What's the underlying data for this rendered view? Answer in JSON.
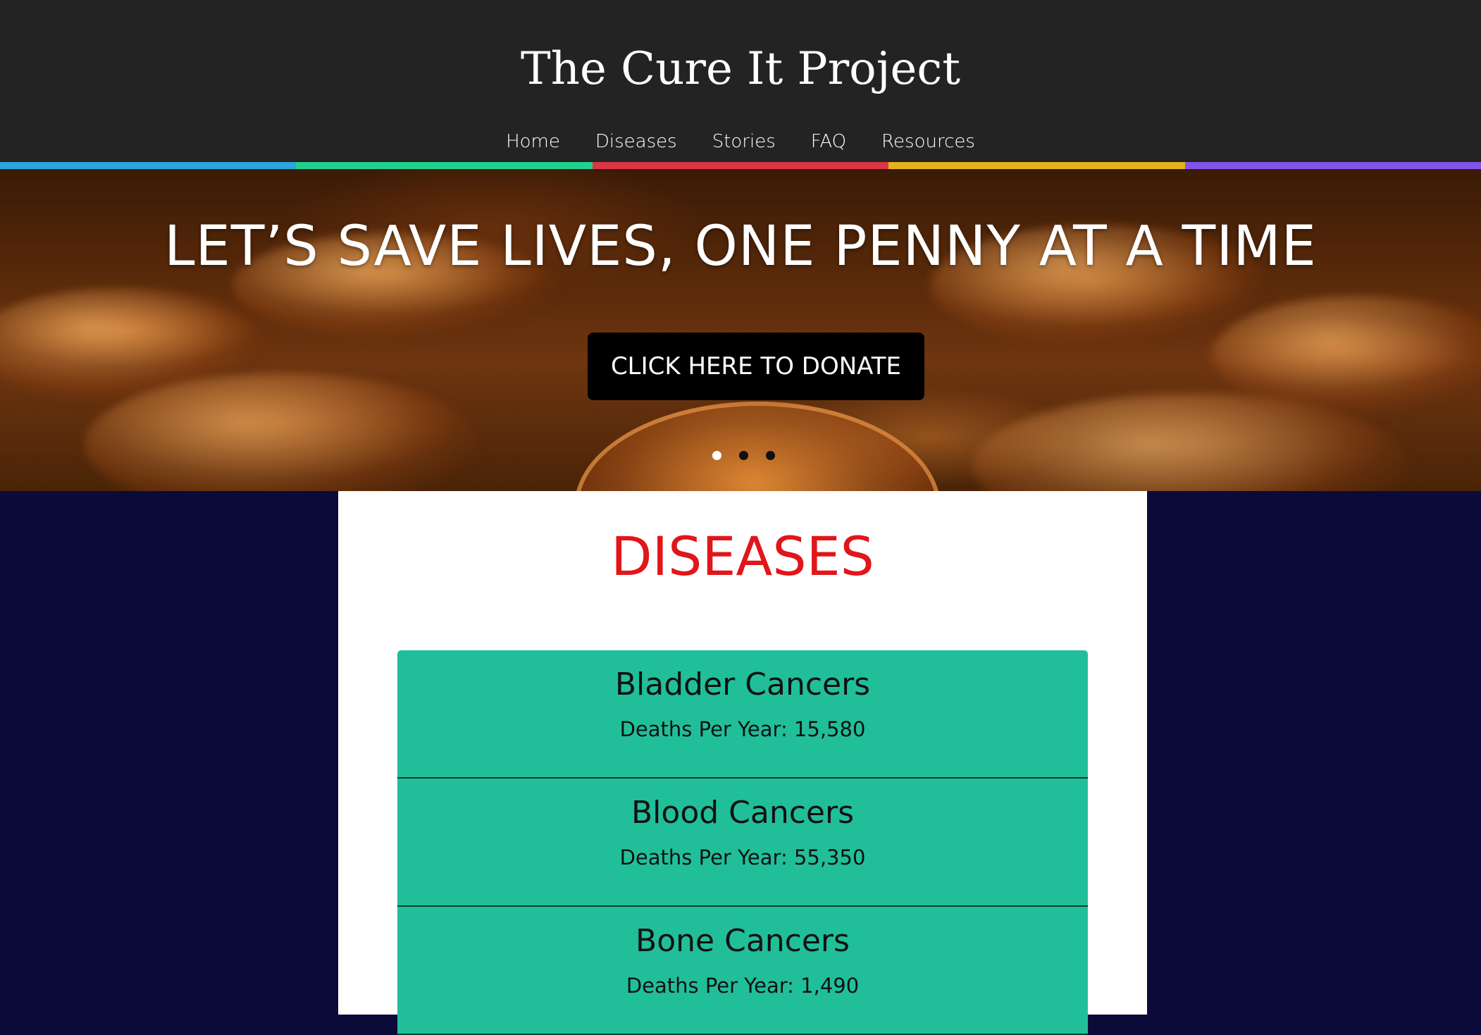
{
  "header": {
    "title": "The Cure It Project",
    "nav": [
      "Home",
      "Diseases",
      "Stories",
      "FAQ",
      "Resources"
    ]
  },
  "accent_colors": [
    "#2aa7df",
    "#21d08f",
    "#dc3545",
    "#e6b21c",
    "#8154ea"
  ],
  "hero": {
    "heading": "LET’S SAVE LIVES, ONE PENNY AT A TIME",
    "donate_label": "CLICK HERE TO DONATE",
    "carousel": {
      "slides": 3,
      "active": 1
    }
  },
  "diseases": {
    "title": "DISEASES",
    "title_color": "#e0161a",
    "item_color": "#20bf9a",
    "items": [
      {
        "name": "Bladder Cancers",
        "deaths": "Deaths Per Year: 15,580"
      },
      {
        "name": "Blood Cancers",
        "deaths": "Deaths Per Year: 55,350"
      },
      {
        "name": "Bone Cancers",
        "deaths": "Deaths Per Year: 1,490"
      }
    ]
  },
  "page_background": "#0c0a38"
}
